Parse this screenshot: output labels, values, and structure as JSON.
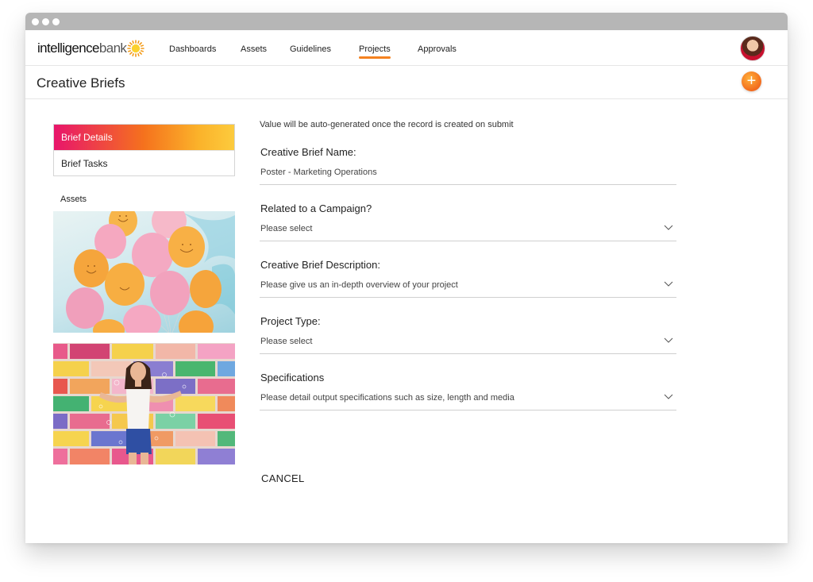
{
  "app": {
    "logo_text_primary": "intelligence",
    "logo_text_secondary": "bank"
  },
  "nav": {
    "items": [
      {
        "label": "Dashboards"
      },
      {
        "label": "Assets"
      },
      {
        "label": "Guidelines"
      },
      {
        "label": "Projects",
        "active": true
      },
      {
        "label": "Approvals"
      }
    ]
  },
  "page": {
    "title": "Creative Briefs",
    "add_icon": "+"
  },
  "side_menu": {
    "items": [
      {
        "label": "Brief Details",
        "active": true
      },
      {
        "label": "Brief Tasks"
      }
    ]
  },
  "assets": {
    "label": "Assets",
    "items": [
      {
        "icon": "balloons-image"
      },
      {
        "icon": "woman-brick-wall-image"
      }
    ]
  },
  "form": {
    "note": "Value will be auto-generated once the record is created on submit",
    "fields": [
      {
        "label": "Creative Brief Name:",
        "value": "Poster - Marketing Operations",
        "type": "text"
      },
      {
        "label": "Related to a Campaign?",
        "value": "Please select",
        "type": "select"
      },
      {
        "label": "Creative Brief Description:",
        "value": "Please give us an in-depth overview of your project",
        "type": "select"
      },
      {
        "label": "Project Type:",
        "value": "Please select",
        "type": "select"
      },
      {
        "label": "Specifications",
        "value": "Please detail output specifications such as size, length and media",
        "type": "select"
      }
    ],
    "cancel_label": "CANCEL"
  },
  "colors": {
    "accent": "#f58220",
    "gradient_start": "#e8156b",
    "gradient_end": "#fccb3d",
    "titlebar": "#b6b6b6"
  }
}
